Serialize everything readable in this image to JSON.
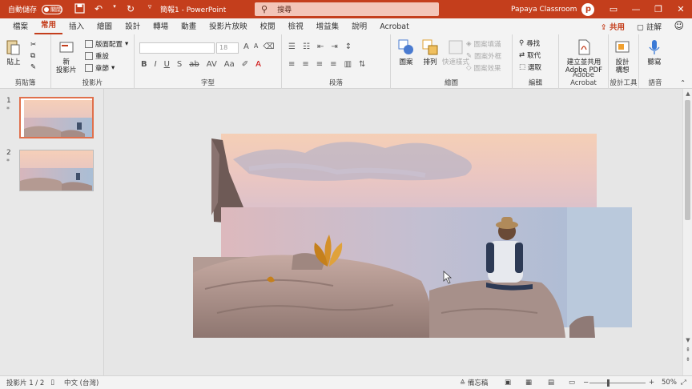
{
  "titlebar": {
    "autosave_label": "自動儲存",
    "autosave_state": "關閉",
    "doc_title": "簡報1 - PowerPoint",
    "search_placeholder": "搜尋",
    "account_name": "Papaya Classroom",
    "avatar_letter": "p",
    "accent_color": "#c43e1c"
  },
  "tabs": [
    "檔案",
    "常用",
    "插入",
    "繪圖",
    "設計",
    "轉場",
    "動畫",
    "投影片放映",
    "校閱",
    "檢視",
    "增益集",
    "說明",
    "Acrobat"
  ],
  "active_tab": "常用",
  "tab_actions": {
    "share": "共用",
    "comment": "註解"
  },
  "ribbon": {
    "clipboard": {
      "label": "剪貼簿",
      "paste": "貼上"
    },
    "slides": {
      "label": "投影片",
      "new_slide_line1": "新",
      "new_slide_line2": "投影片",
      "layout": "版面配置",
      "reset": "重設",
      "section": "章節"
    },
    "font": {
      "label": "字型",
      "size": "18"
    },
    "paragraph": {
      "label": "段落"
    },
    "drawing": {
      "label": "繪圖",
      "shapes": "圖案",
      "arrange": "排列",
      "quick_styles": "快速樣式",
      "shape_fill": "圖案填滿",
      "shape_outline": "圖案外框",
      "shape_effects": "圖案效果"
    },
    "editing": {
      "label": "編輯",
      "find": "尋找",
      "replace": "取代",
      "select": "選取"
    },
    "acrobat": {
      "label": "Adobe Acrobat",
      "line1": "建立並共用",
      "line2": "Adobe PDF"
    },
    "designer": {
      "label": "設計工具",
      "line1": "設計",
      "line2": "構想"
    },
    "voice": {
      "label": "語音",
      "dictate": "聽寫"
    }
  },
  "thumbnails": [
    {
      "number": "1",
      "selected": true
    },
    {
      "number": "2",
      "selected": false
    }
  ],
  "statusbar": {
    "slide_info": "投影片 1 / 2",
    "language": "中文 (台灣)",
    "notes": "備忘稿",
    "zoom": "50%"
  }
}
